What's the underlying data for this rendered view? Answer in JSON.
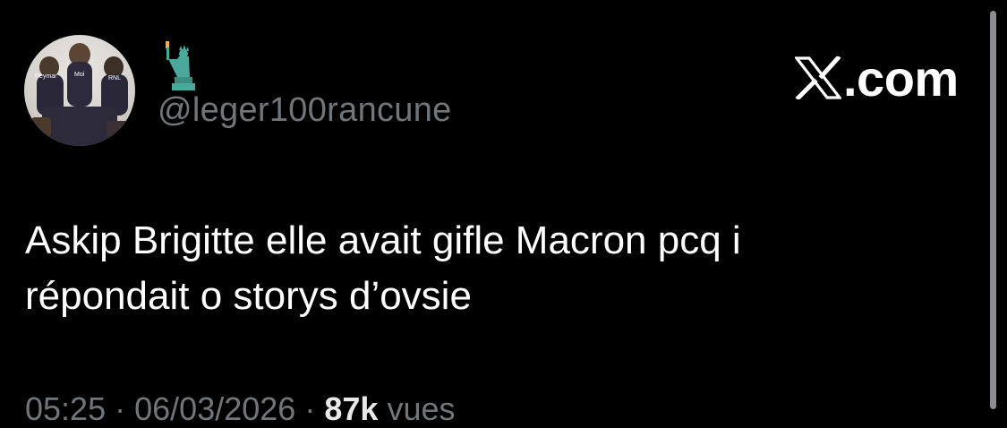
{
  "author": {
    "handle": "@leger100rancune",
    "avatar_labels": [
      "Neymar",
      "Moi",
      "RNL"
    ],
    "badge_icon": "statue-of-liberty-icon"
  },
  "brand": {
    "text": ".com",
    "icon": "x-logo-icon"
  },
  "tweet": {
    "text": "Askip Brigitte elle avait gifle Macron pcq i\nrépondait o storys d’ovsie"
  },
  "meta": {
    "time": "05:25",
    "date": "06/03/2026",
    "separator": "·",
    "views_count": "87k",
    "views_label": "vues"
  },
  "colors": {
    "background": "#000000",
    "text": "#ffffff",
    "secondary": "#71767b"
  }
}
